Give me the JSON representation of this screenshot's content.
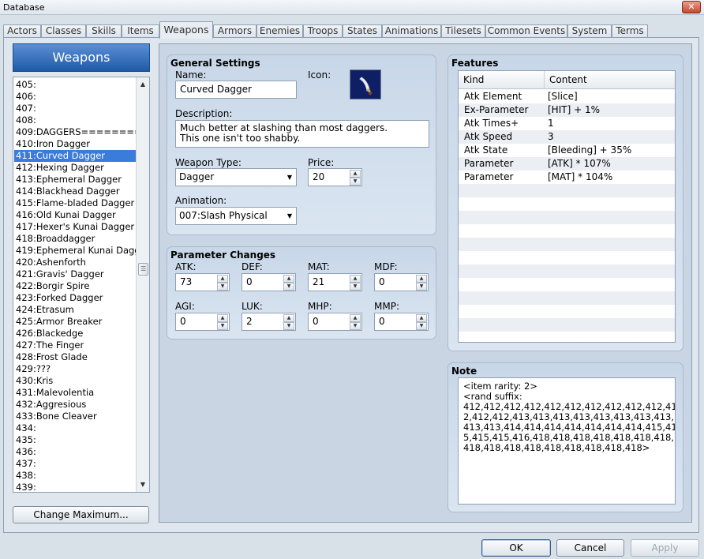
{
  "window": {
    "title": "Database",
    "close_glyph": "✕"
  },
  "tabs": [
    "Actors",
    "Classes",
    "Skills",
    "Items",
    "Weapons",
    "Armors",
    "Enemies",
    "Troops",
    "States",
    "Animations",
    "Tilesets",
    "Common Events",
    "System",
    "Terms"
  ],
  "left": {
    "header": "Weapons",
    "items": [
      "405:",
      "406:",
      "407:",
      "408:",
      "409:DAGGERS=========",
      "410:Iron Dagger",
      "411:Curved Dagger",
      "412:Hexing Dagger",
      "413:Ephemeral Dagger",
      "414:Blackhead Dagger",
      "415:Flame-bladed Dagger",
      "416:Old Kunai Dagger",
      "417:Hexer's Kunai Dagger",
      "418:Broaddagger",
      "419:Ephemeral Kunai Dagger",
      "420:Ashenforth",
      "421:Gravis' Dagger",
      "422:Borgir Spire",
      "423:Forked Dagger",
      "424:Etrasum",
      "425:Armor Breaker",
      "426:Blackedge",
      "427:The Finger",
      "428:Frost Glade",
      "429:???",
      "430:Kris",
      "431:Malevolentia",
      "432:Aggresious",
      "433:Bone Cleaver",
      "434:",
      "435:",
      "436:",
      "437:",
      "438:",
      "439:"
    ],
    "selected_index": 6,
    "change_max_label": "Change Maximum..."
  },
  "general": {
    "title": "General Settings",
    "name_label": "Name:",
    "name_value": "Curved Dagger",
    "icon_label": "Icon:",
    "desc_label": "Description:",
    "desc_line1": "Much better at slashing than most daggers.",
    "desc_line2": "This one isn't too shabby.",
    "type_label": "Weapon Type:",
    "type_value": "Dagger",
    "price_label": "Price:",
    "price_value": "20",
    "anim_label": "Animation:",
    "anim_value": "007:Slash Physical"
  },
  "params": {
    "title": "Parameter Changes",
    "items": [
      {
        "label": "ATK:",
        "value": "73"
      },
      {
        "label": "DEF:",
        "value": "0"
      },
      {
        "label": "MAT:",
        "value": "21"
      },
      {
        "label": "MDF:",
        "value": "0"
      },
      {
        "label": "AGI:",
        "value": "0"
      },
      {
        "label": "LUK:",
        "value": "2"
      },
      {
        "label": "MHP:",
        "value": "0"
      },
      {
        "label": "MMP:",
        "value": "0"
      }
    ]
  },
  "features": {
    "title": "Features",
    "col_kind": "Kind",
    "col_content": "Content",
    "rows": [
      {
        "kind": "Atk Element",
        "content": "[Slice]"
      },
      {
        "kind": "Ex-Parameter",
        "content": "[HIT] + 1%"
      },
      {
        "kind": "Atk Times+",
        "content": "1"
      },
      {
        "kind": "Atk Speed",
        "content": "3"
      },
      {
        "kind": "Atk State",
        "content": "[Bleeding] + 35%"
      },
      {
        "kind": "Parameter",
        "content": "[ATK] * 107%"
      },
      {
        "kind": "Parameter",
        "content": "[MAT] * 104%"
      }
    ]
  },
  "note": {
    "title": "Note",
    "lines": [
      "<item rarity: 2>",
      "<rand suffix:",
      "412,412,412,412,412,412,412,412,412,412,41",
      "2,412,412,413,413,413,413,413,413,413,413,",
      "413,413,414,414,414,414,414,414,414,415,41",
      "5,415,415,416,418,418,418,418,418,418,418,",
      "418,418,418,418,418,418,418,418,418>"
    ]
  },
  "footer": {
    "ok": "OK",
    "cancel": "Cancel",
    "apply": "Apply"
  },
  "glyphs": {
    "up": "▲",
    "down": "▼",
    "grip": "☰"
  }
}
